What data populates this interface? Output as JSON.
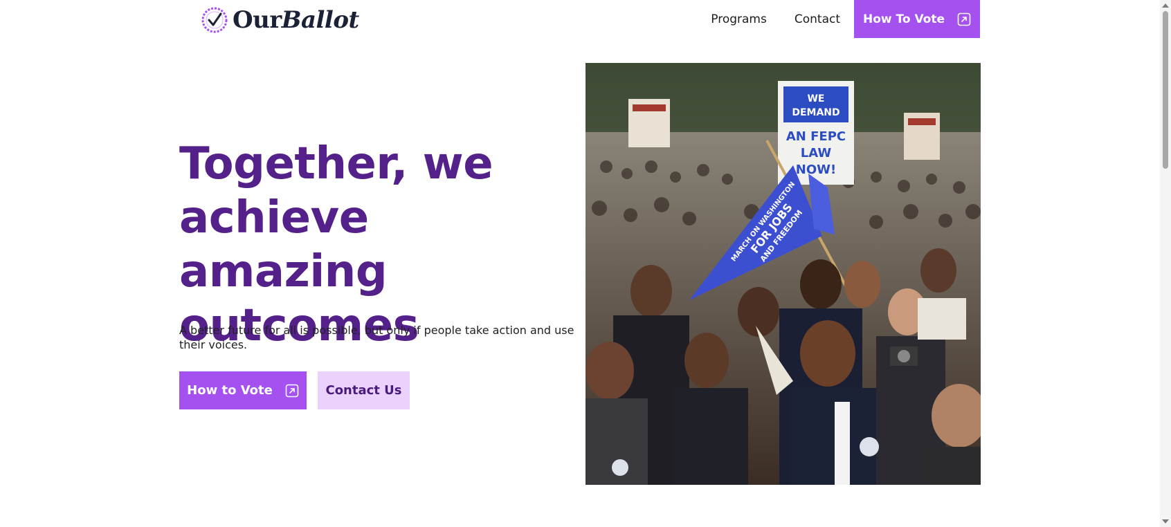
{
  "header": {
    "logo": {
      "text_regular": "Our",
      "text_italic": "Ballot",
      "icon": "check-badge-icon"
    },
    "nav": {
      "items": [
        {
          "label": "Programs"
        },
        {
          "label": "Contact"
        }
      ],
      "cta_label": "How To Vote",
      "cta_icon": "external-link-icon"
    }
  },
  "hero": {
    "title_lines": [
      "Together, we",
      "achieve amazing",
      "outcomes"
    ],
    "subtitle": "A better future for all is possible, but only if people take action and use their voices.",
    "primary_button": {
      "label": "How to Vote",
      "icon": "external-link-icon"
    },
    "secondary_button": {
      "label": "Contact Us"
    },
    "image": {
      "sign_text": [
        "WE",
        "DEMAND",
        "AN FEPC",
        "LAW",
        "NOW!"
      ],
      "pennant_text": [
        "MARCH ON WASHINGTON",
        "FOR JOBS",
        "AND FREEDOM"
      ]
    }
  },
  "theme": {
    "accent": "#a551f0",
    "accent_light": "#ead2fd",
    "heading": "#54208a",
    "logo_text": "#1c2236"
  }
}
